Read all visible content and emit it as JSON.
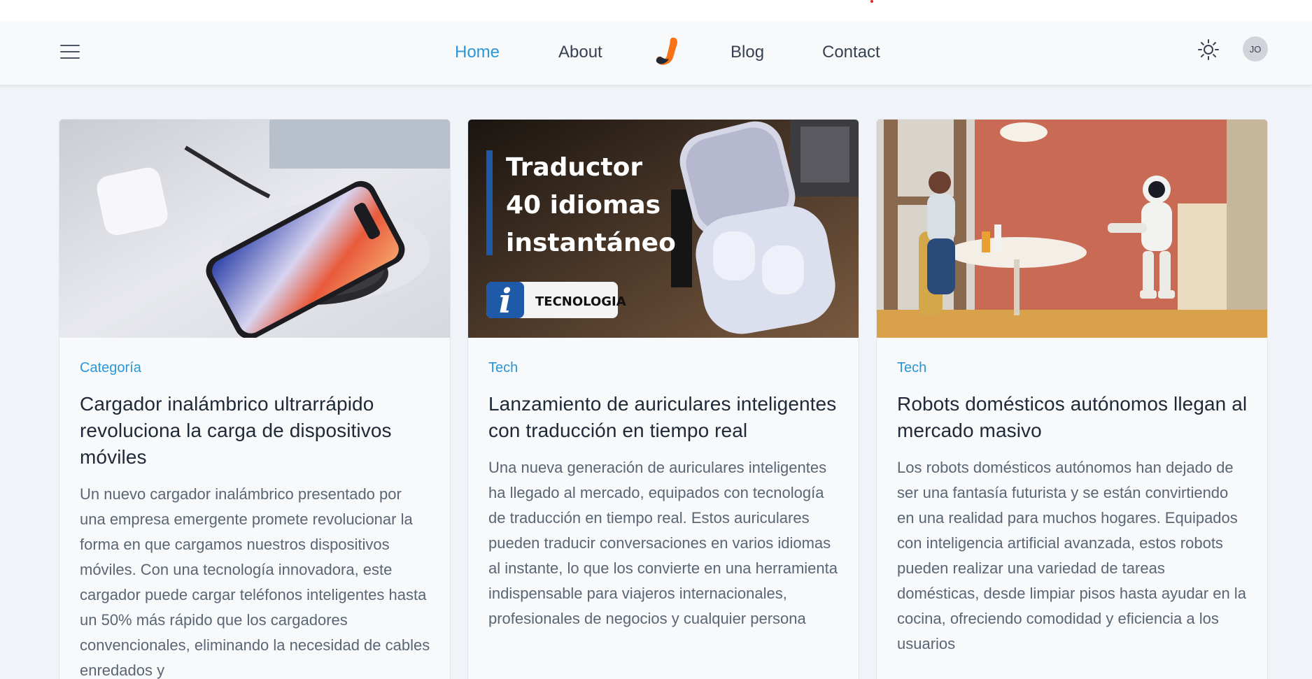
{
  "nav": {
    "links": [
      {
        "label": "Home",
        "active": true
      },
      {
        "label": "About",
        "active": false
      },
      {
        "label": "Blog",
        "active": false
      },
      {
        "label": "Contact",
        "active": false
      }
    ],
    "avatar_initials": "JO",
    "accent_color": "#2a97d8",
    "logo_colors": [
      "#f97316",
      "#1f2937"
    ]
  },
  "cards": [
    {
      "image": "wireless-charger-phone-photo",
      "category": "Categoría",
      "title": "Cargador inalámbrico ultrarrápido revoluciona la carga de dispositivos móviles",
      "excerpt": "Un nuevo cargador inalámbrico presentado por una empresa emergente promete revolucionar la forma en que cargamos nuestros dispositivos móviles. Con una tecnología innovadora, este cargador puede cargar teléfonos inteligentes hasta un 50% más rápido que los cargadores convencionales, eliminando la necesidad de cables enredados y"
    },
    {
      "image": "translator-earbuds-photo",
      "image_text": {
        "lines": [
          "Traductor",
          "40 idiomas",
          "instantáneo"
        ],
        "badge": "TECNOLOGIA",
        "badge_letter": "i"
      },
      "category": "Tech",
      "title": "Lanzamiento de auriculares inteligentes con traducción en tiempo real",
      "excerpt": "Una nueva generación de auriculares inteligentes ha llegado al mercado, equipados con tecnología de traducción en tiempo real. Estos auriculares pueden traducir conversaciones en varios idiomas al instante, lo que los convierte en una herramienta indispensable para viajeros internacionales, profesionales de negocios y cualquier persona"
    },
    {
      "image": "home-robot-kitchen-photo",
      "category": "Tech",
      "title": "Robots domésticos autónomos llegan al mercado masivo",
      "excerpt": "Los robots domésticos autónomos han dejado de ser una fantasía futurista y se están convirtiendo en una realidad para muchos hogares. Equipados con inteligencia artificial avanzada, estos robots pueden realizar una variedad de tareas domésticas, desde limpiar pisos hasta ayudar en la cocina, ofreciendo comodidad y eficiencia a los usuarios"
    }
  ]
}
